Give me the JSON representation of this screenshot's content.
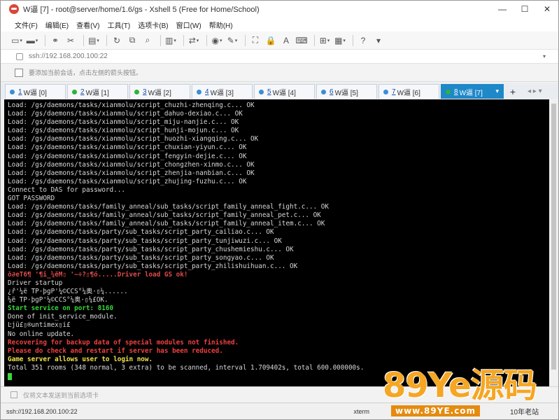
{
  "window": {
    "title": "W逼 [7] - root@server/home/1.6/gs - Xshell 5 (Free for Home/School)",
    "minimize": "—",
    "maximize": "☐",
    "close": "✕"
  },
  "menu": {
    "items": [
      "文件(F)",
      "编辑(E)",
      "查看(V)",
      "工具(T)",
      "选项卡(B)",
      "窗口(W)",
      "帮助(H)"
    ]
  },
  "toolbar": {
    "icons": [
      "new-session-icon",
      "open-folder-icon",
      "separator",
      "link-icon",
      "unlink-icon",
      "separator",
      "properties-icon",
      "separator",
      "refresh-icon",
      "copy-icon",
      "find-icon",
      "separator",
      "print-icon",
      "separator",
      "transfer-icon",
      "separator",
      "globe-icon",
      "pen-icon",
      "separator",
      "fullscreen-icon",
      "lock-icon",
      "font-icon",
      "keyboard-icon",
      "separator",
      "compose-icon",
      "layout-icon",
      "separator",
      "help-icon",
      "settings-icon"
    ]
  },
  "address": {
    "url": "ssh://192.168.200.100:22",
    "dropdown": "▾"
  },
  "hint": {
    "text": "要添加当前会话，点击左侧的箭头按钮。"
  },
  "tabs": [
    {
      "num": "1",
      "label": "W逼 [0]",
      "dot": "#3b8ed6",
      "active": false
    },
    {
      "num": "2",
      "label": "W逼 [1]",
      "dot": "#2db33a",
      "active": false
    },
    {
      "num": "3",
      "label": "W逼 [2]",
      "dot": "#2db33a",
      "active": false
    },
    {
      "num": "4",
      "label": "W逼 [3]",
      "dot": "#3b8ed6",
      "active": false
    },
    {
      "num": "5",
      "label": "W逼 [4]",
      "dot": "#3b8ed6",
      "active": false
    },
    {
      "num": "6",
      "label": "W逼 [5]",
      "dot": "#3b8ed6",
      "active": false
    },
    {
      "num": "7",
      "label": "W逼 [6]",
      "dot": "#3b8ed6",
      "active": false
    },
    {
      "num": "8",
      "label": "W逼 [7]",
      "dot": "#2db33a",
      "active": true
    }
  ],
  "tab_add": "+",
  "tab_nav": "◂ ▸ ▾",
  "terminal": {
    "lines": [
      {
        "text": "Load: /gs/daemons/tasks/xianmolu/script_chuzhi-zhenqing.c... OK",
        "style": "normal"
      },
      {
        "text": "Load: /gs/daemons/tasks/xianmolu/script_dahuo-dexiao.c... OK",
        "style": "normal"
      },
      {
        "text": "Load: /gs/daemons/tasks/xianmolu/script_miju-nanjie.c... OK",
        "style": "normal"
      },
      {
        "text": "Load: /gs/daemons/tasks/xianmolu/script_hunji-mojun.c... OK",
        "style": "normal"
      },
      {
        "text": "Load: /gs/daemons/tasks/xianmolu/script_huozhi-xiangqing.c... OK",
        "style": "normal"
      },
      {
        "text": "Load: /gs/daemons/tasks/xianmolu/script_chuxian-yiyun.c... OK",
        "style": "normal"
      },
      {
        "text": "Load: /gs/daemons/tasks/xianmolu/script_fengyin-dejie.c... OK",
        "style": "normal"
      },
      {
        "text": "Load: /gs/daemons/tasks/xianmolu/script_chongzhen-xinmo.c... OK",
        "style": "normal"
      },
      {
        "text": "Load: /gs/daemons/tasks/xianmolu/script_zhenjia-nanbian.c... OK",
        "style": "normal"
      },
      {
        "text": "Load: /gs/daemons/tasks/xianmolu/script_zhujing-fuzhu.c... OK",
        "style": "normal"
      },
      {
        "text": "Connect to DAS for password...",
        "style": "normal"
      },
      {
        "text": "GOT PASSWORD",
        "style": "normal"
      },
      {
        "text": "Load: /gs/daemons/tasks/family_anneal/sub_tasks/script_family_anneal_fight.c... OK",
        "style": "normal"
      },
      {
        "text": "Load: /gs/daemons/tasks/family_anneal/sub_tasks/script_family_anneal_pet.c... OK",
        "style": "normal"
      },
      {
        "text": "Load: /gs/daemons/tasks/family_anneal/sub_tasks/script_family_anneal_item.c... OK",
        "style": "normal"
      },
      {
        "text": "Load: /gs/daemons/tasks/party/sub_tasks/script_party_cailiao.c... OK",
        "style": "normal"
      },
      {
        "text": "Load: /gs/daemons/tasks/party/sub_tasks/script_party_tunjiwuzi.c... OK",
        "style": "normal"
      },
      {
        "text": "Load: /gs/daemons/tasks/party/sub_tasks/script_party_chushemieshu.c... OK",
        "style": "normal"
      },
      {
        "text": "Load: /gs/daemons/tasks/party/sub_tasks/script_party_songyao.c... OK",
        "style": "normal"
      },
      {
        "text": "Load: /gs/daemons/tasks/party/sub_tasks/script_party_zhilishuihuan.c... OK",
        "style": "normal"
      },
      {
        "text": "ŏ∂eT6¶ '¶i_¼ëM▯ '~÷?▯¶ó.....Driver load GS ok!",
        "style": "garbled"
      },
      {
        "text": "Driver startup",
        "style": "normal"
      },
      {
        "text": "¿ř'¼ë TP·þgP'¼©CCS°¼奥·▯¼......",
        "style": "normal"
      },
      {
        "text": "¼ë TP·þgP'¼©CCS°¼奥·▯¼£OK.",
        "style": "normal"
      },
      {
        "text": "Start service on port: 8160",
        "style": "green"
      },
      {
        "text": "Done of init_service_module.",
        "style": "normal"
      },
      {
        "text": "Ŀjü£▯®untimex▯i£",
        "style": "normal"
      },
      {
        "text": "No online update.",
        "style": "normal"
      },
      {
        "text": "Recovering for backup data of special modules not finished.",
        "style": "red"
      },
      {
        "text": "Please do check and restart if server has been reduced.",
        "style": "red"
      },
      {
        "text": "Game server allows user to login now.",
        "style": "yellow"
      },
      {
        "text": "Total 351 rooms (348 normal, 3 extra) to be scanned, interval 1.709402s, total 600.000000s.",
        "style": "normal"
      }
    ]
  },
  "compose": {
    "text": "仅将文本发送到当前选项卡"
  },
  "status": {
    "address": "ssh://192.168.200.100:22",
    "term": "xterm"
  },
  "watermark": {
    "big": "89Ye源码",
    "small": "www.89YE.com",
    "tag": "10年老站"
  }
}
